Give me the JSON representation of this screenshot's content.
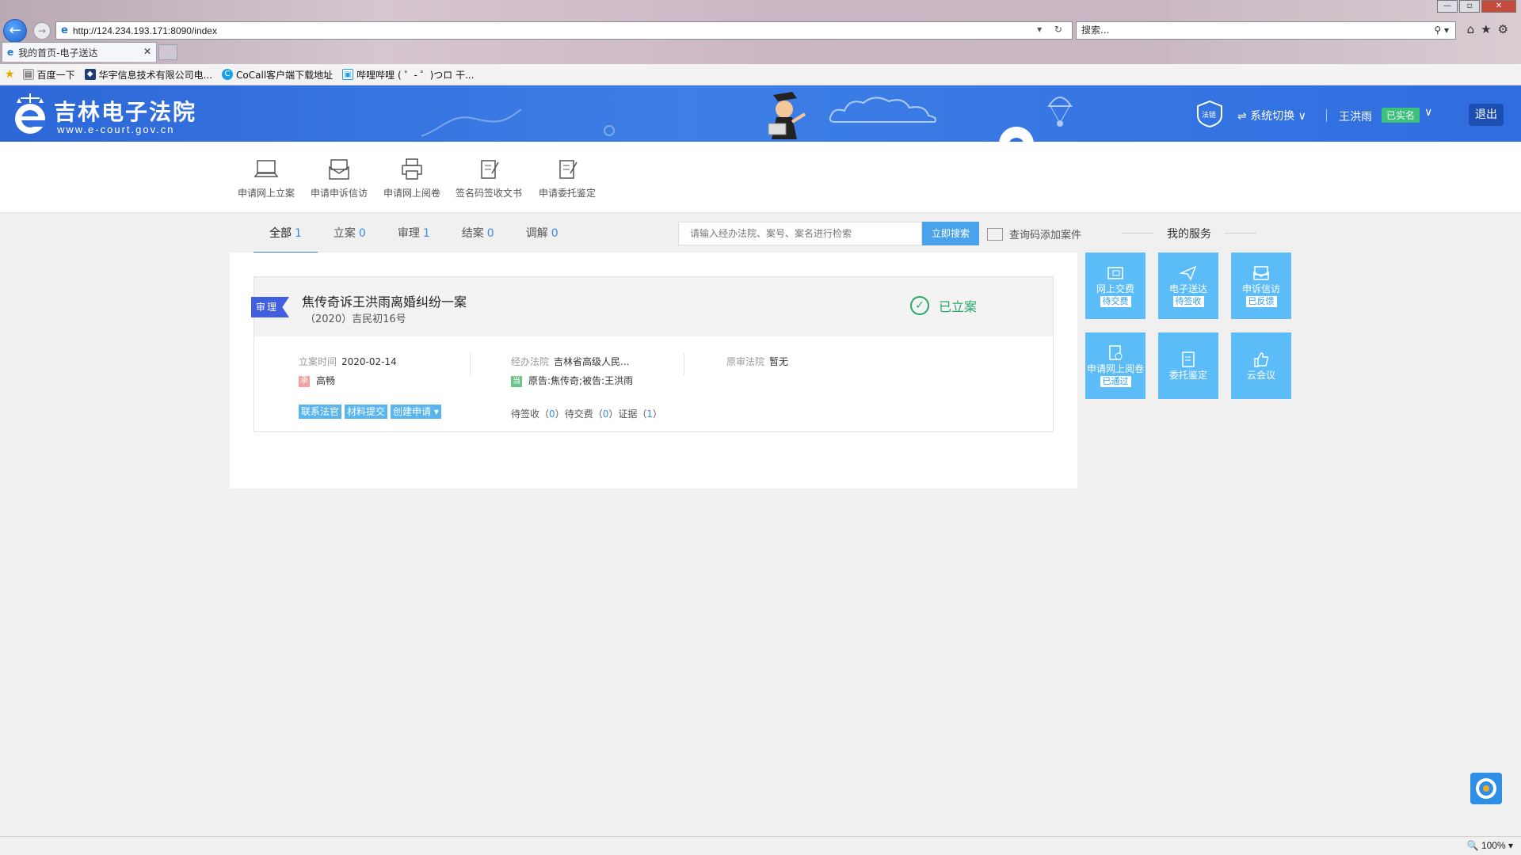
{
  "browser": {
    "url": "http://124.234.193.171:8090/index",
    "search_placeholder": "搜索...",
    "tab_title": "我的首页-电子送达",
    "favorites": [
      "百度一下",
      "华宇信息技术有限公司电...",
      "CoCall客户端下载地址",
      "哔哩哔哩 ( ゜- ゜)つロ 干..."
    ],
    "zoom": "100%"
  },
  "header": {
    "title": "吉林电子法院",
    "subtitle": "www.e-court.gov.cn",
    "fabu": "法链",
    "system_switch": "系统切换",
    "user_name": "王洪雨",
    "real_name_badge": "已实名",
    "logout": "退出"
  },
  "quick_actions": [
    {
      "label": "申请网上立案",
      "icon": "laptop-icon"
    },
    {
      "label": "申请申诉信访",
      "icon": "envelope-icon"
    },
    {
      "label": "申请网上阅卷",
      "icon": "printer-icon"
    },
    {
      "label": "签名码签收文书",
      "icon": "document-edit-icon"
    },
    {
      "label": "申请委托鉴定",
      "icon": "document-edit-icon"
    }
  ],
  "case_tabs": [
    {
      "label": "全部",
      "count": "1",
      "active": true
    },
    {
      "label": "立案",
      "count": "0"
    },
    {
      "label": "审理",
      "count": "1"
    },
    {
      "label": "结案",
      "count": "0"
    },
    {
      "label": "调解",
      "count": "0"
    }
  ],
  "search": {
    "placeholder": "请输入经办法院、案号、案名进行检索",
    "button": "立即搜索",
    "qrcode_add": "查询码添加案件"
  },
  "case": {
    "stage": "审理",
    "title": "焦传奇诉王洪雨离婚纠纷一案",
    "number": "（2020）吉民初16号",
    "status": "已立案",
    "filing_date_label": "立案时间",
    "filing_date": "2020-02-14",
    "judge_tag": "承",
    "judge": "高畅",
    "court_label": "经办法院",
    "court": "吉林省高级人民...",
    "parties_tag": "当",
    "parties": "原告:焦传奇;被告:王洪雨",
    "original_court_label": "原审法院",
    "original_court": "暂无",
    "actions": [
      "联系法官",
      "材料提交",
      "创建申请 ▾"
    ],
    "counts": {
      "pending_sign_label": "待签收",
      "pending_sign": "0",
      "pending_pay_label": "待交费",
      "pending_pay": "0",
      "evidence_label": "证据",
      "evidence": "1"
    }
  },
  "my_services": {
    "title": "我的服务",
    "tiles": [
      {
        "label": "网上交费",
        "badge": "待交费",
        "icon": "wallet-icon"
      },
      {
        "label": "电子送达",
        "badge": "待签收",
        "icon": "paper-plane-icon"
      },
      {
        "label": "申诉信访",
        "badge": "已反馈",
        "icon": "envelope-icon"
      },
      {
        "label": "申请网上阅卷",
        "badge": "已通过",
        "icon": "document-check-icon"
      },
      {
        "label": "委托鉴定",
        "badge": "",
        "icon": "document-edit-icon"
      },
      {
        "label": "云会议",
        "badge": "",
        "icon": "thumbs-up-icon"
      }
    ]
  },
  "colors": {
    "header_blue": "#2f6de0",
    "tile_blue": "#5bbcf7",
    "status_green": "#24a86a",
    "stage_blue": "#3f5fe0",
    "link_blue": "#3a8ee6"
  }
}
